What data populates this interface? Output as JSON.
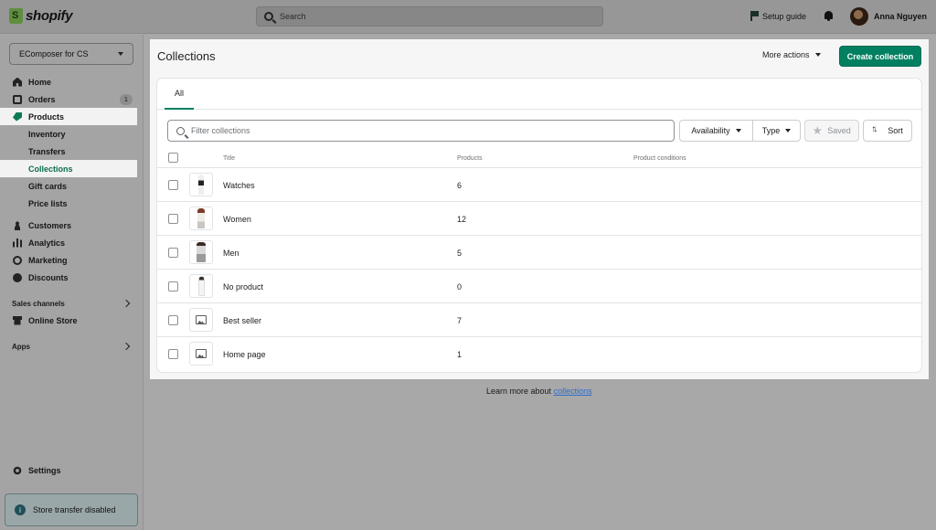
{
  "topbar": {
    "logo_text": "shopify",
    "search_placeholder": "Search",
    "setup_guide": "Setup guide",
    "user_name": "Anna Nguyen"
  },
  "sidebar": {
    "store_name": "EComposer for CS",
    "items": [
      {
        "label": "Home",
        "icon": "home-icon"
      },
      {
        "label": "Orders",
        "icon": "orders-icon",
        "badge": "1"
      },
      {
        "label": "Products",
        "icon": "tag-icon"
      },
      {
        "label": "Inventory"
      },
      {
        "label": "Transfers"
      },
      {
        "label": "Collections"
      },
      {
        "label": "Gift cards"
      },
      {
        "label": "Price lists"
      },
      {
        "label": "Customers",
        "icon": "person-icon"
      },
      {
        "label": "Analytics",
        "icon": "bar-chart-icon"
      },
      {
        "label": "Marketing",
        "icon": "target-icon"
      },
      {
        "label": "Discounts",
        "icon": "discount-icon"
      }
    ],
    "sales_channels_label": "Sales channels",
    "online_store": "Online Store",
    "apps_label": "Apps",
    "settings": "Settings",
    "transfer_notice": "Store transfer disabled"
  },
  "main": {
    "title": "Collections",
    "more_actions": "More actions",
    "create_button": "Create collection",
    "tab_all": "All",
    "filter_placeholder": "Filter collections",
    "availability": "Availability",
    "type": "Type",
    "saved": "Saved",
    "sort": "Sort",
    "columns": [
      "Title",
      "Products",
      "Product conditions"
    ],
    "rows": [
      {
        "title": "Watches",
        "products": "6",
        "thumb": "product-photo"
      },
      {
        "title": "Women",
        "products": "12",
        "thumb": "product-photo"
      },
      {
        "title": "Men",
        "products": "5",
        "thumb": "product-photo"
      },
      {
        "title": "No product",
        "products": "0",
        "thumb": "product-photo"
      },
      {
        "title": "Best seller",
        "products": "7",
        "thumb": "image-placeholder-icon"
      },
      {
        "title": "Home page",
        "products": "1",
        "thumb": "image-placeholder-icon"
      }
    ]
  },
  "footer": {
    "learn_more": "Learn more about",
    "link": "collections"
  },
  "colors": {
    "accent": "#008060",
    "link": "#2c6ecb",
    "overlay": "#a8a8a8"
  }
}
